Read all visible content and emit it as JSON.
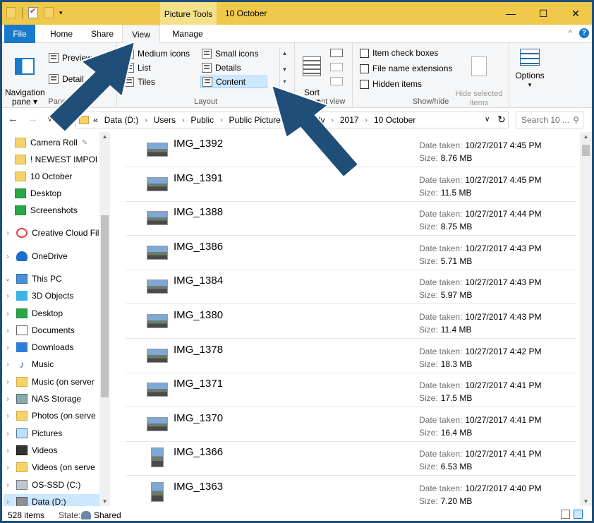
{
  "titlebar": {
    "contextual_tab": "Picture Tools",
    "window_title": "10 October",
    "minimize": "—",
    "maximize": "☐",
    "close": "✕"
  },
  "tabs": {
    "file": "File",
    "home": "Home",
    "share": "Share",
    "view": "View",
    "manage": "Manage",
    "collapse": "^",
    "help": "?"
  },
  "ribbon": {
    "panes": {
      "navigation_pane": "Navigation\npane ▾",
      "preview": "Preview",
      "details": "Detail",
      "label": "Panes"
    },
    "layout": {
      "medium_icons": "Medium icons",
      "small_icons": "Small icons",
      "list": "List",
      "details": "Details",
      "tiles": "Tiles",
      "content": "Content",
      "label": "Layout"
    },
    "current_view": {
      "sort_by": "Sort\nby ▾",
      "label": "Current view"
    },
    "show_hide": {
      "item_check_boxes": "Item check boxes",
      "file_name_extensions": "File name extensions",
      "hidden_items": "Hidden items",
      "hide_selected": "Hide selected\nitems",
      "label": "Show/hide"
    },
    "options": {
      "label": "Options",
      "caret": "▾"
    }
  },
  "address": {
    "back": "←",
    "forward": "→",
    "chevron": "«",
    "crumbs": [
      "Data (D:)",
      "Users",
      "Public",
      "Public Pictures",
      "Family",
      "2017",
      "10 October"
    ],
    "dropdown": "∨",
    "refresh": "↻",
    "search_placeholder": "Search 10 ...",
    "search_icon": "⚲"
  },
  "nav": {
    "items": [
      {
        "label": "Camera Roll",
        "icon": "folder",
        "pinned": true
      },
      {
        "label": "! NEWEST IMPOI",
        "icon": "folder"
      },
      {
        "label": "10 October",
        "icon": "folder"
      },
      {
        "label": "Desktop",
        "icon": "green"
      },
      {
        "label": "Screenshots",
        "icon": "green"
      },
      {
        "label": "Creative Cloud Fil",
        "icon": "cloud",
        "expandable": true
      },
      {
        "label": "OneDrive",
        "icon": "od",
        "expandable": true
      },
      {
        "label": "This PC",
        "icon": "pc",
        "expanded": true
      },
      {
        "label": "3D Objects",
        "icon": "cube",
        "expandable": true
      },
      {
        "label": "Desktop",
        "icon": "green",
        "expandable": true
      },
      {
        "label": "Documents",
        "icon": "doc",
        "expandable": true
      },
      {
        "label": "Downloads",
        "icon": "down",
        "expandable": true
      },
      {
        "label": "Music",
        "icon": "music",
        "expandable": true
      },
      {
        "label": "Music (on server",
        "icon": "folder",
        "expandable": true
      },
      {
        "label": "NAS Storage",
        "icon": "net",
        "expandable": true
      },
      {
        "label": "Photos (on serve",
        "icon": "folder",
        "expandable": true
      },
      {
        "label": "Pictures",
        "icon": "pict",
        "expandable": true
      },
      {
        "label": "Videos",
        "icon": "vid",
        "expandable": true
      },
      {
        "label": "Videos (on serve",
        "icon": "folder",
        "expandable": true
      },
      {
        "label": "OS-SSD (C:)",
        "icon": "drive",
        "expandable": true
      },
      {
        "label": "Data (D:)",
        "icon": "data",
        "expandable": true,
        "selected": true
      }
    ],
    "pin_icon": "📌",
    "expand_glyph": "›",
    "expanded_glyph": "⌄"
  },
  "files": {
    "date_label": "Date taken:",
    "size_label": "Size:",
    "rows": [
      {
        "name": "IMG_1392",
        "date": "10/27/2017 4:45 PM",
        "size": "8.76 MB"
      },
      {
        "name": "IMG_1391",
        "date": "10/27/2017 4:45 PM",
        "size": "11.5 MB"
      },
      {
        "name": "IMG_1388",
        "date": "10/27/2017 4:44 PM",
        "size": "8.75 MB"
      },
      {
        "name": "IMG_1386",
        "date": "10/27/2017 4:43 PM",
        "size": "5.71 MB"
      },
      {
        "name": "IMG_1384",
        "date": "10/27/2017 4:43 PM",
        "size": "5.97 MB"
      },
      {
        "name": "IMG_1380",
        "date": "10/27/2017 4:43 PM",
        "size": "11.4 MB"
      },
      {
        "name": "IMG_1378",
        "date": "10/27/2017 4:42 PM",
        "size": "18.3 MB"
      },
      {
        "name": "IMG_1371",
        "date": "10/27/2017 4:41 PM",
        "size": "17.5 MB"
      },
      {
        "name": "IMG_1370",
        "date": "10/27/2017 4:41 PM",
        "size": "16.4 MB"
      },
      {
        "name": "IMG_1366",
        "date": "10/27/2017 4:41 PM",
        "size": "6.53 MB",
        "portrait": true
      },
      {
        "name": "IMG_1363",
        "date": "10/27/2017 4:40 PM",
        "size": "7.20 MB",
        "portrait": true
      }
    ]
  },
  "status": {
    "items": "528 items",
    "state_label": "State:",
    "state_value": "Shared"
  },
  "colors": {
    "titlebar": "#f0c84a",
    "accent": "#1979ca",
    "selection": "#cce8ff",
    "annotation_arrow": "#1f4e79"
  }
}
